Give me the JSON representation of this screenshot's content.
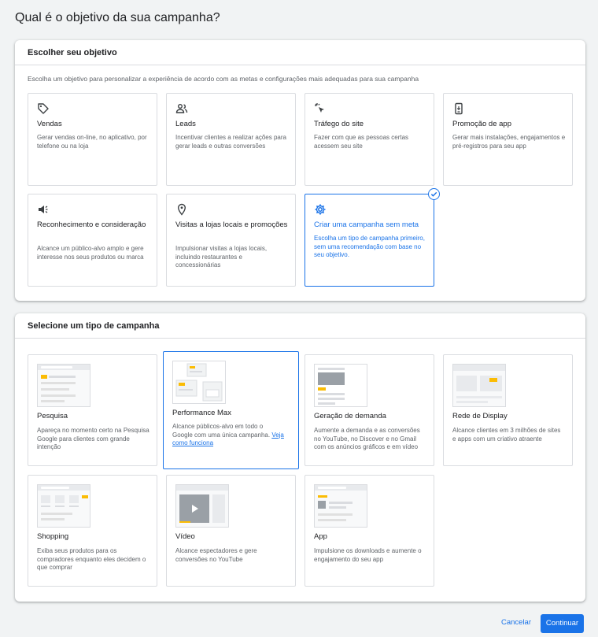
{
  "page": {
    "title": "Qual é o objetivo da sua campanha?"
  },
  "objective_panel": {
    "header": "Escolher seu objetivo",
    "description": "Escolha um objetivo para personalizar a experiência de acordo com as metas e configurações mais adequadas para sua campanha",
    "cards": [
      {
        "icon": "tag-icon",
        "title": "Vendas",
        "desc": "Gerar vendas on-line, no aplicativo, por telefone ou na loja"
      },
      {
        "icon": "people-icon",
        "title": "Leads",
        "desc": "Incentivar clientes a realizar ações para gerar leads e outras conversões"
      },
      {
        "icon": "cursor-click-icon",
        "title": "Tráfego do site",
        "desc": "Fazer com que as pessoas certas acessem seu site"
      },
      {
        "icon": "phone-app-icon",
        "title": "Promoção de app",
        "desc": "Gerar mais instalações, engajamentos e pré-registros para seu app"
      },
      {
        "icon": "megaphone-icon",
        "title": "Reconhecimento e consideração",
        "desc": "Alcance um público-alvo amplo e gere interesse nos seus produtos ou marca"
      },
      {
        "icon": "location-pin-icon",
        "title": "Visitas a lojas locais e promoções",
        "desc": "Impulsionar visitas a lojas locais, incluindo restaurantes e concessionárias"
      },
      {
        "icon": "gear-icon",
        "title": "Criar uma campanha sem meta",
        "desc": "Escolha um tipo de campanha primeiro, sem uma recomendação com base no seu objetivo.",
        "selected": true
      }
    ]
  },
  "campaign_type_panel": {
    "header": "Selecione um tipo de campanha",
    "cards": [
      {
        "title": "Pesquisa",
        "desc": "Apareça no momento certo na Pesquisa Google para clientes com grande intenção"
      },
      {
        "title": "Performance Max",
        "desc": "Alcance públicos-alvo em todo o Google com uma única campanha.",
        "link": "Veja como funciona",
        "selected": true
      },
      {
        "title": "Geração de demanda",
        "desc": "Aumente a demanda e as conversões no YouTube, no Discover e no Gmail com os anúncios gráficos e em vídeo"
      },
      {
        "title": "Rede de Display",
        "desc": "Alcance clientes em 3 milhões de sites e apps com um criativo atraente"
      },
      {
        "title": "Shopping",
        "desc": "Exiba seus produtos para os compradores enquanto eles decidem o que comprar"
      },
      {
        "title": "Vídeo",
        "desc": "Alcance espectadores e gere conversões no YouTube"
      },
      {
        "title": "App",
        "desc": "Impulsione os downloads e aumente o engajamento do seu app"
      }
    ]
  },
  "footer": {
    "cancel": "Cancelar",
    "continue": "Continuar"
  },
  "colors": {
    "accent": "#1a73e8",
    "highlight": "#fbbc04",
    "border": "#dadce0"
  }
}
